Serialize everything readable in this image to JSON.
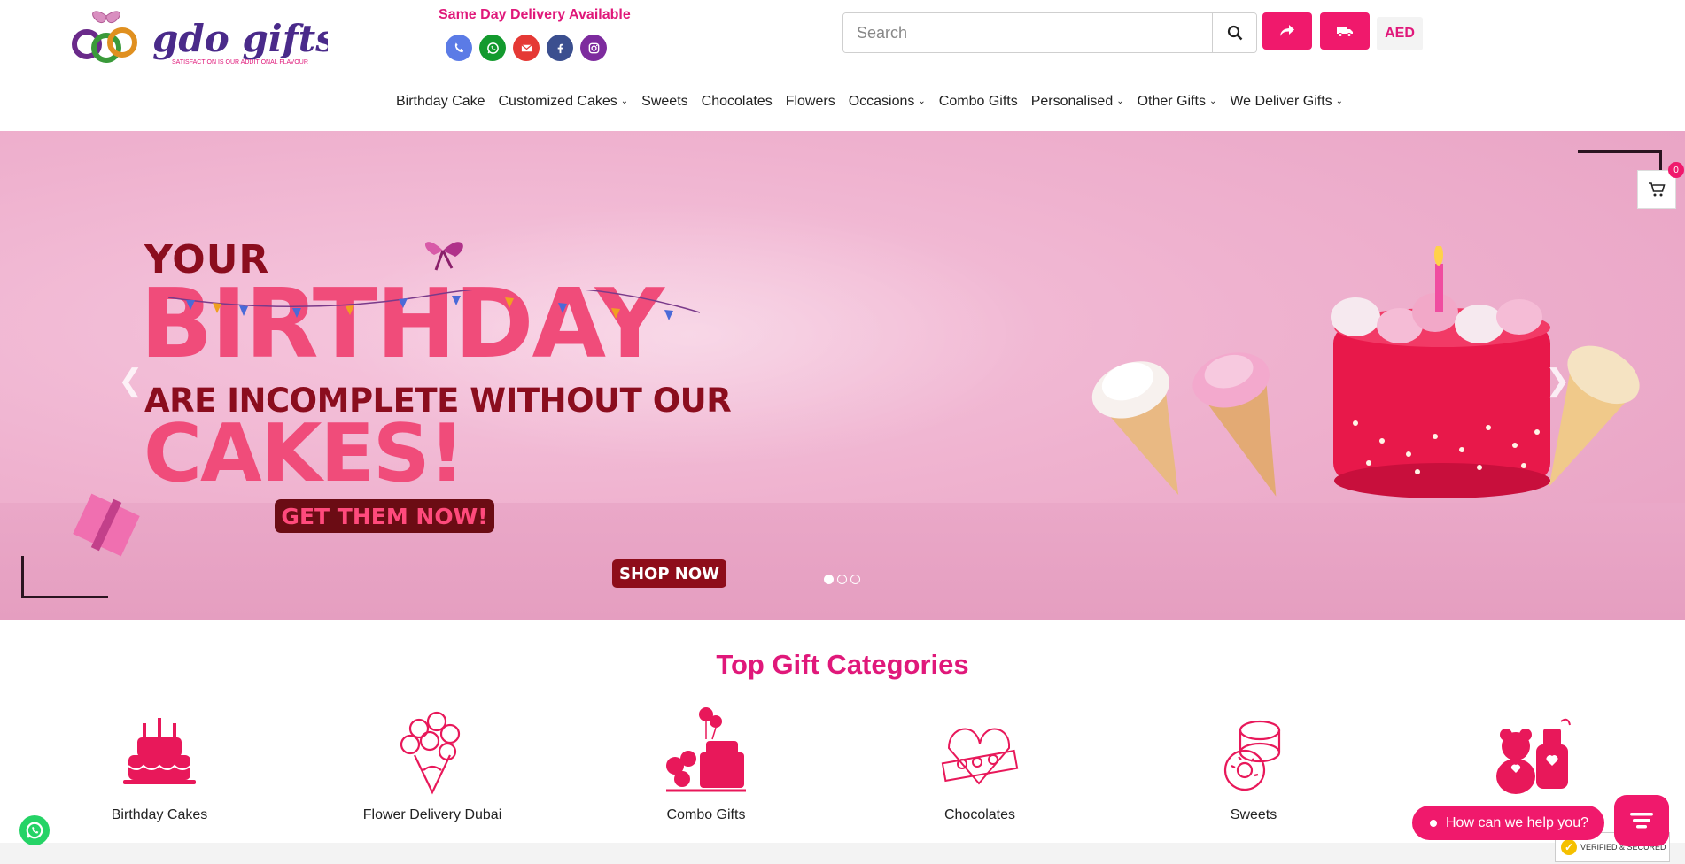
{
  "header": {
    "logo_text": "gdo gifts",
    "logo_tagline": "SATISFACTION IS OUR ADDITIONAL FLAVOUR",
    "delivery_note": "Same Day Delivery Available",
    "socials": [
      {
        "icon": "phone-icon",
        "color": "#5b7be6"
      },
      {
        "icon": "whatsapp-icon",
        "color": "#139a2e"
      },
      {
        "icon": "email-icon",
        "color": "#e53935"
      },
      {
        "icon": "facebook-icon",
        "color": "#3b4f8f"
      },
      {
        "icon": "instagram-icon",
        "color": "#7d2b9e"
      }
    ],
    "search_placeholder": "Search",
    "currency": "AED"
  },
  "nav": {
    "items": [
      {
        "label": "Birthday Cake",
        "dropdown": false
      },
      {
        "label": "Customized Cakes",
        "dropdown": true
      },
      {
        "label": "Sweets",
        "dropdown": false
      },
      {
        "label": "Chocolates",
        "dropdown": false
      },
      {
        "label": "Flowers",
        "dropdown": false
      },
      {
        "label": "Occasions",
        "dropdown": true
      },
      {
        "label": "Combo Gifts",
        "dropdown": false
      },
      {
        "label": "Personalised",
        "dropdown": true
      },
      {
        "label": "Other Gifts",
        "dropdown": true
      },
      {
        "label": "We Deliver Gifts",
        "dropdown": true
      }
    ]
  },
  "hero": {
    "line1": "YOUR",
    "line2": "BIRTHDAY",
    "line3": "ARE INCOMPLETE WITHOUT OUR",
    "line4": "CAKES!",
    "cta1": "GET THEM NOW!",
    "cta2": "SHOP NOW",
    "slides": 3,
    "active_slide": 1,
    "cart_count": "0"
  },
  "categories": {
    "title": "Top Gift Categories",
    "items": [
      {
        "label": "Birthday Cakes",
        "icon": "birthday-cake-icon"
      },
      {
        "label": "Flower Delivery Dubai",
        "icon": "flower-bouquet-icon"
      },
      {
        "label": "Combo Gifts",
        "icon": "combo-gift-icon"
      },
      {
        "label": "Chocolates",
        "icon": "chocolate-box-icon"
      },
      {
        "label": "Sweets",
        "icon": "sweets-icon"
      },
      {
        "label": "",
        "icon": "teddy-gift-icon"
      }
    ]
  },
  "chat": {
    "help_text": "How can we help you?"
  },
  "badge": {
    "text": "VERIFIED & SECURED"
  },
  "colors": {
    "brand_pink": "#f0196c",
    "heading_pink": "#e0187a"
  }
}
